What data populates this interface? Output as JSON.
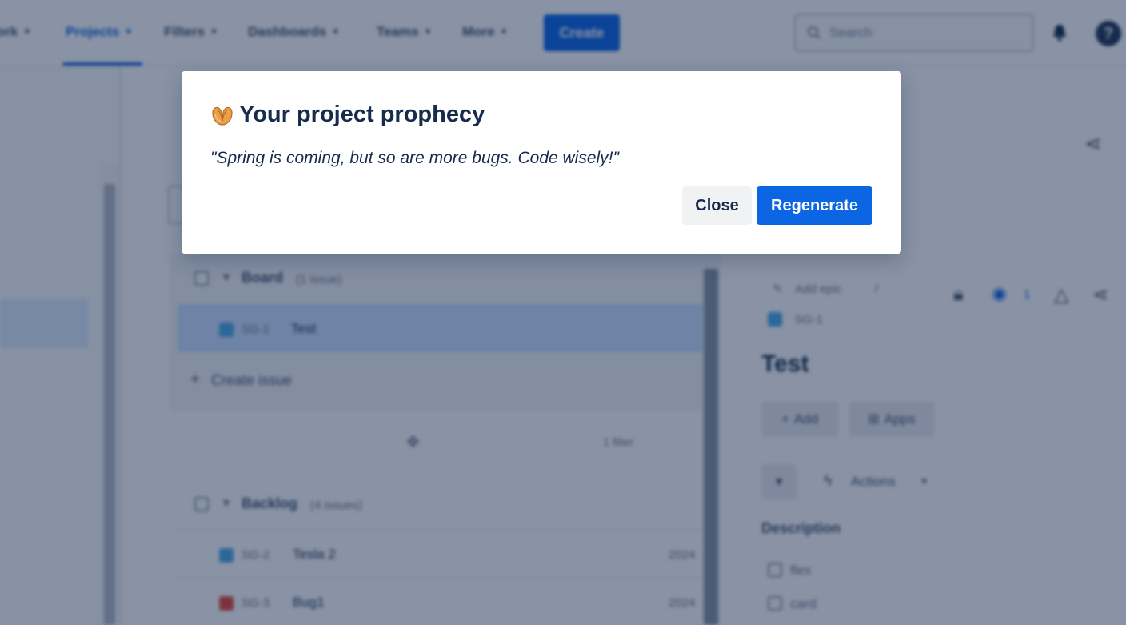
{
  "nav": {
    "items": [
      {
        "label": "ork"
      },
      {
        "label": "Projects"
      },
      {
        "label": "Filters"
      },
      {
        "label": "Dashboards"
      },
      {
        "label": "Teams"
      },
      {
        "label": "More"
      }
    ],
    "create_label": "Create",
    "search_placeholder": "Search",
    "accent_color": "#0c66e4"
  },
  "backlog": {
    "board": {
      "name": "Board",
      "count": "(1 issue)"
    },
    "issues_top": [
      {
        "key": "SG-1",
        "summary": "Test"
      }
    ],
    "create_issue_label": "Create issue",
    "filter_hint": "1 filter",
    "backlog_section": {
      "name": "Backlog",
      "count": "(4 issues)"
    },
    "issues": [
      {
        "key": "SG-2",
        "summary": "Tesla 2",
        "value": "2024"
      },
      {
        "key": "SG-3",
        "summary": "Bug1",
        "value": "2024"
      }
    ]
  },
  "detail": {
    "add_epic": "Add epic",
    "issue_key": "SG-1",
    "watch_count": "1",
    "title": "Test",
    "add_label": "Add",
    "apps_label": "Apps",
    "status_label": "Actions",
    "description_label": "Description",
    "checklist": [
      "flex",
      "card"
    ]
  },
  "modal": {
    "icon": "fortune-cookie-icon",
    "title": "Your project prophecy",
    "quote": "\"Spring is coming, but so are more bugs. Code wisely!\"",
    "close_label": "Close",
    "regenerate_label": "Regenerate"
  }
}
